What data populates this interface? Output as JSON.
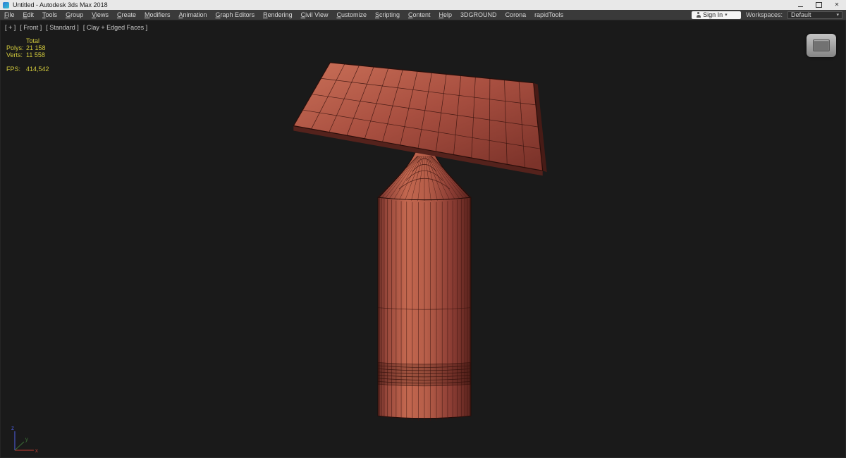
{
  "window": {
    "title": "Untitled - Autodesk 3ds Max 2018"
  },
  "menu": {
    "items": [
      "File",
      "Edit",
      "Tools",
      "Group",
      "Views",
      "Create",
      "Modifiers",
      "Animation",
      "Graph Editors",
      "Rendering",
      "Civil View",
      "Customize",
      "Scripting",
      "Content",
      "Help",
      "3DGROUND",
      "Corona",
      "rapidTools"
    ],
    "no_underline": [
      "3DGROUND",
      "Corona",
      "rapidTools"
    ]
  },
  "account": {
    "sign_in_label": "Sign In",
    "workspaces_label": "Workspaces:",
    "workspace_value": "Default"
  },
  "viewport": {
    "segments": [
      {
        "label": "[ + ]"
      },
      {
        "label": "[ Front ]"
      },
      {
        "label": "[ Standard ]"
      },
      {
        "label": "[ Clay + Edged Faces ]"
      }
    ],
    "stats": {
      "total_label": "Total",
      "polys_label": "Polys:",
      "polys_value": "21 158",
      "verts_label": "Verts:",
      "verts_value": "11 558",
      "fps_label": "FPS:",
      "fps_value": "414,542"
    },
    "background": "#1a1a1a",
    "gizmo_labels": {
      "x": "x",
      "y": "y",
      "z": "z"
    }
  },
  "model": {
    "colors": {
      "wire": "#38130e",
      "outline": "#220b08",
      "slab_bottom": "#54221c",
      "slab_side": "#471b16",
      "band_shade": "rgba(30,8,5,0.22)",
      "cylinder_stops": [
        [
          "0",
          "#6f3129"
        ],
        [
          "0.08",
          "#95463a"
        ],
        [
          "0.3",
          "#c2674f"
        ],
        [
          "0.52",
          "#b65e49"
        ],
        [
          "0.8",
          "#8a3c33"
        ],
        [
          "1",
          "#5c241e"
        ]
      ],
      "plane_stops": [
        [
          "0",
          "#ca7058"
        ],
        [
          "0.5",
          "#a84f40"
        ],
        [
          "1",
          "#7c332a"
        ]
      ],
      "axis_x": "#b03a2e",
      "axis_y": "#3f7a3a",
      "axis_z": "#4b5bd6"
    }
  }
}
